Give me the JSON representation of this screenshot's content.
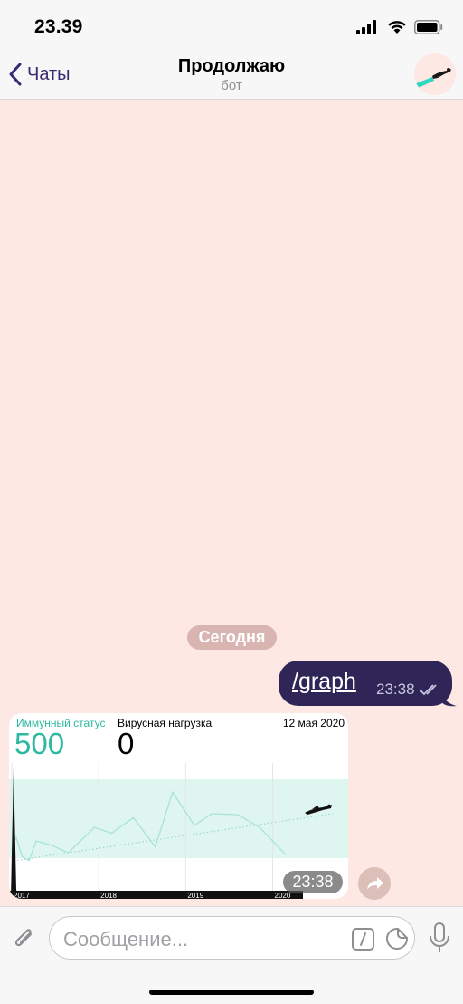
{
  "status_bar": {
    "time": "23.39",
    "icons": [
      "cellular-signal-icon",
      "wifi-icon",
      "battery-icon"
    ]
  },
  "nav": {
    "back_label": "Чаты",
    "title": "Продолжаю",
    "subtitle": "бот"
  },
  "chat": {
    "date_divider": "Сегодня",
    "outgoing_message": {
      "text": "/graph",
      "time": "23:38",
      "status": "read"
    },
    "incoming_photo": {
      "time": "23:38",
      "immune_label": "Иммунный статус",
      "immune_value": "500",
      "viral_label": "Вирусная нагрузка",
      "viral_value": "0",
      "date": "12 мая 2020"
    }
  },
  "chart_data": {
    "type": "line",
    "title": "",
    "xlabel": "",
    "ylabel": "",
    "x_tick_labels": [
      "2017",
      "2018",
      "2019",
      "2020"
    ],
    "series": [
      {
        "color": "#a8e3d6",
        "points": [
          [
            2017.0,
            355
          ],
          [
            2017.05,
            420
          ],
          [
            2017.12,
            320
          ],
          [
            2017.2,
            300
          ],
          [
            2017.28,
            400
          ],
          [
            2017.45,
            380
          ],
          [
            2017.65,
            340
          ],
          [
            2017.95,
            470
          ],
          [
            2018.15,
            440
          ],
          [
            2018.4,
            520
          ],
          [
            2018.65,
            370
          ],
          [
            2018.85,
            650
          ],
          [
            2019.1,
            480
          ],
          [
            2019.3,
            540
          ],
          [
            2019.6,
            535
          ],
          [
            2019.85,
            470
          ],
          [
            2020.15,
            330
          ]
        ]
      }
    ],
    "reference_band": {
      "color": "#dff5f0"
    },
    "trend_line": {
      "color": "#8fd3c4",
      "style": "dotted"
    },
    "colors": {
      "accent_teal": "#2db8a0",
      "bubble_out": "#2f2657",
      "background": "#fde8e3"
    }
  },
  "input_bar": {
    "placeholder": "Сообщение..."
  },
  "colors": {
    "nav_accent": "#3a2a73",
    "chat_background": "#fde8e3"
  }
}
